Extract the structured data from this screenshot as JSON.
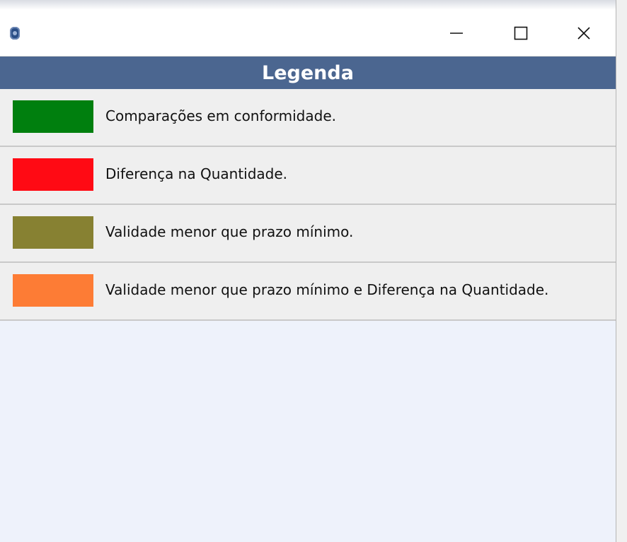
{
  "header": {
    "title": "Legenda"
  },
  "legend": {
    "items": [
      {
        "label": "Comparações em conformidade.",
        "color": "#007f0e"
      },
      {
        "label": "Diferença na Quantidade.",
        "color": "#ff0a14"
      },
      {
        "label": "Validade menor que prazo mínimo.",
        "color": "#878132"
      },
      {
        "label": "Validade menor que prazo mínimo e Diferença na Quantidade.",
        "color": "#fd7c35"
      }
    ]
  },
  "window": {
    "icons": {
      "app": "app-icon",
      "minimize": "minimize-icon",
      "maximize": "maximize-icon",
      "close": "close-icon"
    }
  }
}
